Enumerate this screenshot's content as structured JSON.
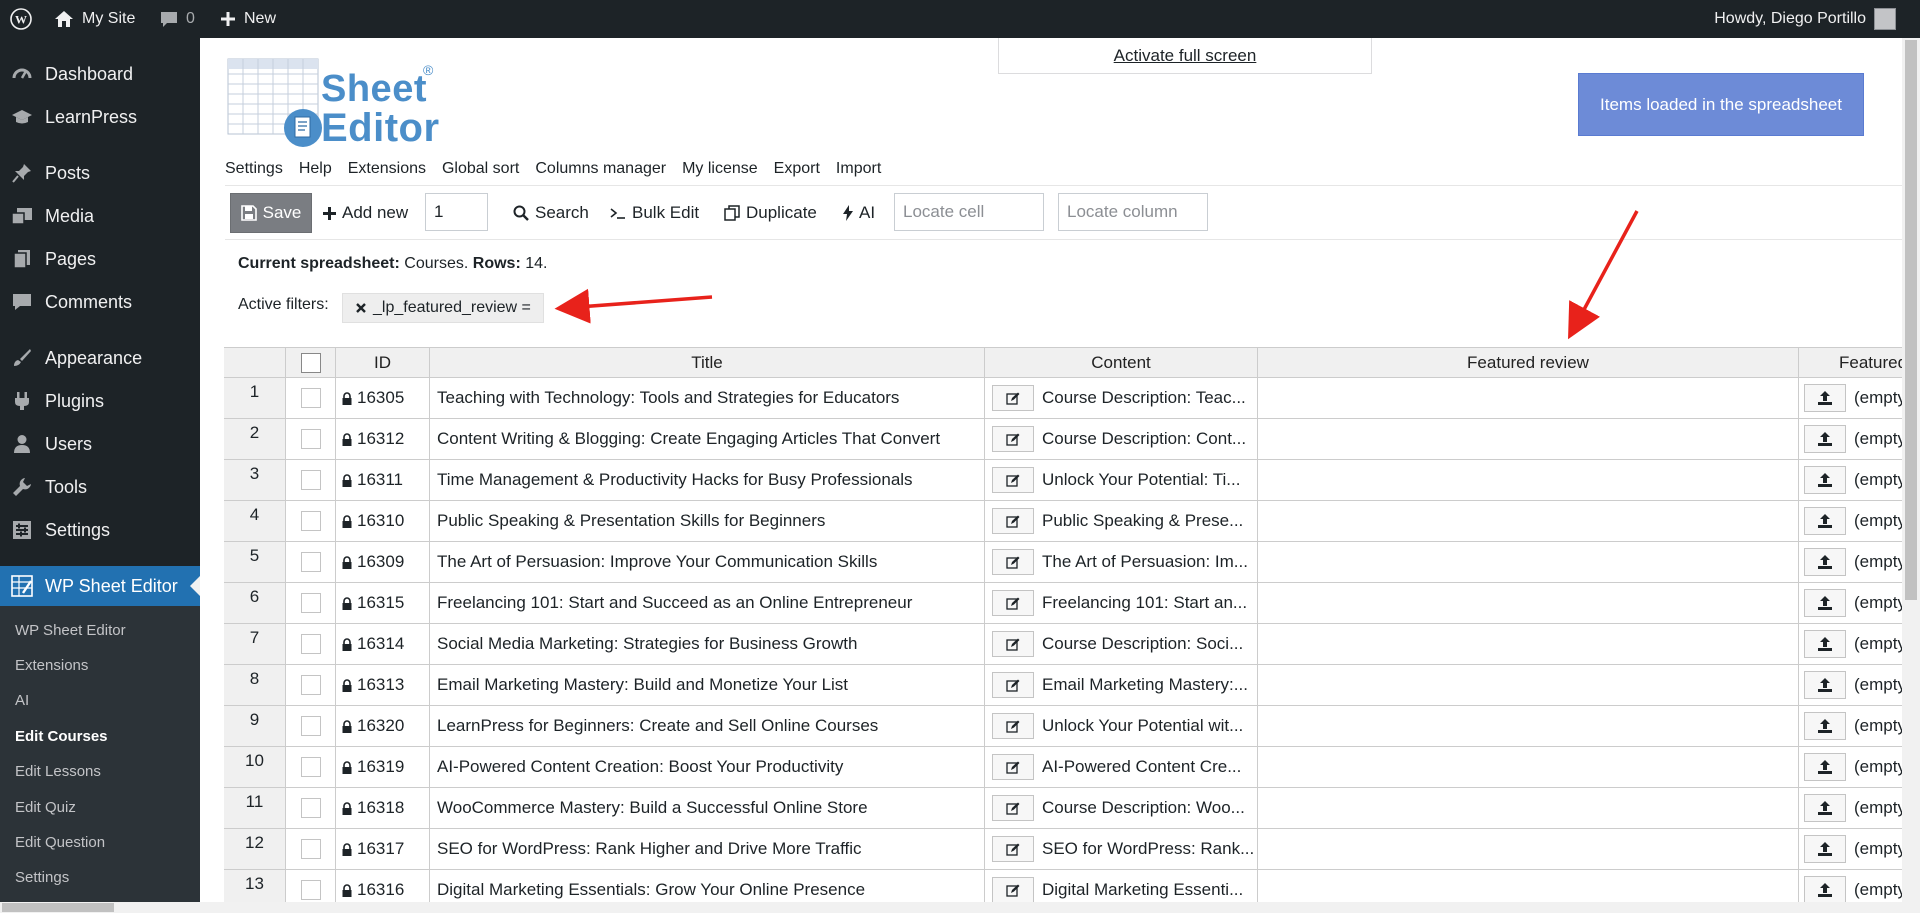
{
  "adminbar": {
    "site_name": "My Site",
    "comments_count": "0",
    "new_label": "New",
    "howdy": "Howdy, Diego Portillo"
  },
  "sidebar": {
    "items": [
      {
        "label": "Dashboard",
        "icon": "dashboard-icon"
      },
      {
        "label": "LearnPress",
        "icon": "graduation-cap-icon"
      },
      {
        "label": "Posts",
        "icon": "pin-icon"
      },
      {
        "label": "Media",
        "icon": "media-icon"
      },
      {
        "label": "Pages",
        "icon": "pages-icon"
      },
      {
        "label": "Comments",
        "icon": "comment-icon"
      },
      {
        "label": "Appearance",
        "icon": "brush-icon"
      },
      {
        "label": "Plugins",
        "icon": "plug-icon"
      },
      {
        "label": "Users",
        "icon": "user-icon"
      },
      {
        "label": "Tools",
        "icon": "wrench-icon"
      },
      {
        "label": "Settings",
        "icon": "settings-icon"
      },
      {
        "label": "WP Sheet Editor",
        "icon": "sheet-editor-icon"
      }
    ],
    "submenu": [
      "WP Sheet Editor",
      "Extensions",
      "AI",
      "Edit Courses",
      "Edit Lessons",
      "Edit Quiz",
      "Edit Question",
      "Settings"
    ]
  },
  "logo": {
    "line1": "Sheet",
    "line2": "Editor",
    "reg": "®"
  },
  "fullscreen_link": "Activate full screen",
  "items_loaded": "Items loaded in the spreadsheet",
  "topnav": [
    "Settings",
    "Help",
    "Extensions",
    "Global sort",
    "Columns manager",
    "My license",
    "Export",
    "Import"
  ],
  "toolbar": {
    "save": "Save",
    "add_new": "Add new",
    "add_new_count": "1",
    "search": "Search",
    "bulk_edit": "Bulk Edit",
    "duplicate": "Duplicate",
    "ai": "AI",
    "locate_cell_placeholder": "Locate cell",
    "locate_column_placeholder": "Locate column"
  },
  "info": {
    "current_label": "Current spreadsheet:",
    "current_value": "Courses.",
    "rows_label": "Rows:",
    "rows_value": "14."
  },
  "filters": {
    "label": "Active filters:",
    "chip": "_lp_featured_review ="
  },
  "columns": [
    "ID",
    "Title",
    "Content",
    "Featured review",
    "Featured"
  ],
  "rows": [
    {
      "n": "1",
      "id": "16305",
      "title": "Teaching with Technology: Tools and Strategies for Educators",
      "content": "Course Description: Teac...",
      "featured": "(empty)"
    },
    {
      "n": "2",
      "id": "16312",
      "title": "Content Writing & Blogging: Create Engaging Articles That Convert",
      "content": "Course Description: Cont...",
      "featured": "(empty)"
    },
    {
      "n": "3",
      "id": "16311",
      "title": "Time Management & Productivity Hacks for Busy Professionals",
      "content": "Unlock Your Potential: Ti...",
      "featured": "(empty)"
    },
    {
      "n": "4",
      "id": "16310",
      "title": "Public Speaking & Presentation Skills for Beginners",
      "content": "Public Speaking & Prese...",
      "featured": "(empty)"
    },
    {
      "n": "5",
      "id": "16309",
      "title": "The Art of Persuasion: Improve Your Communication Skills",
      "content": "The Art of Persuasion: Im...",
      "featured": "(empty)"
    },
    {
      "n": "6",
      "id": "16315",
      "title": "Freelancing 101: Start and Succeed as an Online Entrepreneur",
      "content": "Freelancing 101: Start an...",
      "featured": "(empty)"
    },
    {
      "n": "7",
      "id": "16314",
      "title": "Social Media Marketing: Strategies for Business Growth",
      "content": "Course Description: Soci...",
      "featured": "(empty)"
    },
    {
      "n": "8",
      "id": "16313",
      "title": "Email Marketing Mastery: Build and Monetize Your List",
      "content": "Email Marketing Mastery:...",
      "featured": "(empty)"
    },
    {
      "n": "9",
      "id": "16320",
      "title": "LearnPress for Beginners: Create and Sell Online Courses",
      "content": "Unlock Your Potential wit...",
      "featured": "(empty)"
    },
    {
      "n": "10",
      "id": "16319",
      "title": "AI-Powered Content Creation: Boost Your Productivity",
      "content": "AI-Powered Content Cre...",
      "featured": "(empty)"
    },
    {
      "n": "11",
      "id": "16318",
      "title": "WooCommerce Mastery: Build a Successful Online Store",
      "content": "Course Description: Woo...",
      "featured": "(empty)"
    },
    {
      "n": "12",
      "id": "16317",
      "title": "SEO for WordPress: Rank Higher and Drive More Traffic",
      "content": "SEO for WordPress: Rank...",
      "featured": "(empty)"
    },
    {
      "n": "13",
      "id": "16316",
      "title": "Digital Marketing Essentials: Grow Your Online Presence",
      "content": "Digital Marketing Essenti...",
      "featured": "(empty)"
    }
  ],
  "colors": {
    "admin_dark": "#1d2327",
    "menu_active": "#2271b1",
    "loaded_box": "#6d8bd7",
    "save_btn": "#7a7d82",
    "annotation_arrow": "#e8221b"
  }
}
